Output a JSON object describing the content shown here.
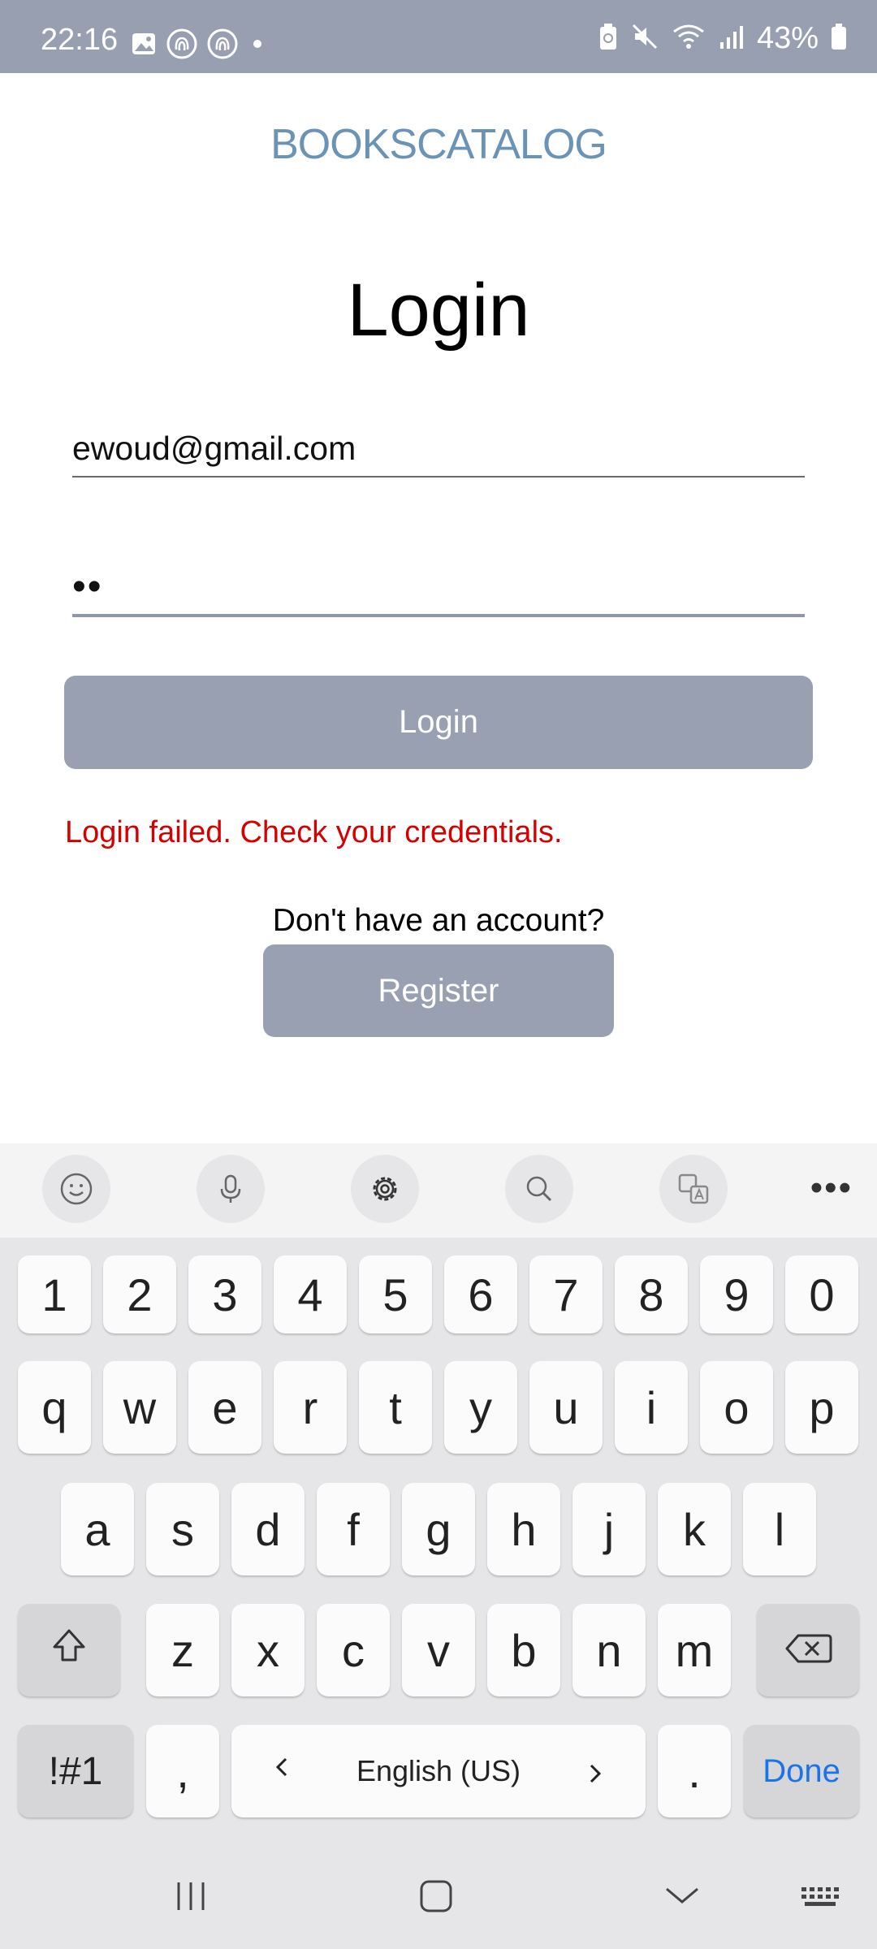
{
  "status_bar": {
    "time": "22:16",
    "battery": "43%"
  },
  "app": {
    "title": "BOOKSCATALOG",
    "heading": "Login",
    "email_value": "ewoud@gmail.com",
    "password_value": "••",
    "login_button": "Login",
    "error": "Login failed. Check your credentials.",
    "no_account": "Don't have an account?",
    "register_button": "Register"
  },
  "keyboard": {
    "toolbar": [
      "emoji-icon",
      "mic-icon",
      "settings-icon",
      "search-icon",
      "translate-icon",
      "more-icon"
    ],
    "more": "•••",
    "row1": [
      "1",
      "2",
      "3",
      "4",
      "5",
      "6",
      "7",
      "8",
      "9",
      "0"
    ],
    "row2": [
      "q",
      "w",
      "e",
      "r",
      "t",
      "y",
      "u",
      "i",
      "o",
      "p"
    ],
    "row3": [
      "a",
      "s",
      "d",
      "f",
      "g",
      "h",
      "j",
      "k",
      "l"
    ],
    "row4": [
      "z",
      "x",
      "c",
      "v",
      "b",
      "n",
      "m"
    ],
    "symbols": "!#1",
    "comma": ",",
    "space_label": "English (US)",
    "period": ".",
    "done": "Done"
  },
  "colors": {
    "accent": "#98a0b1",
    "title": "#6a93b6",
    "error": "#d50000",
    "done": "#1a73e8"
  }
}
